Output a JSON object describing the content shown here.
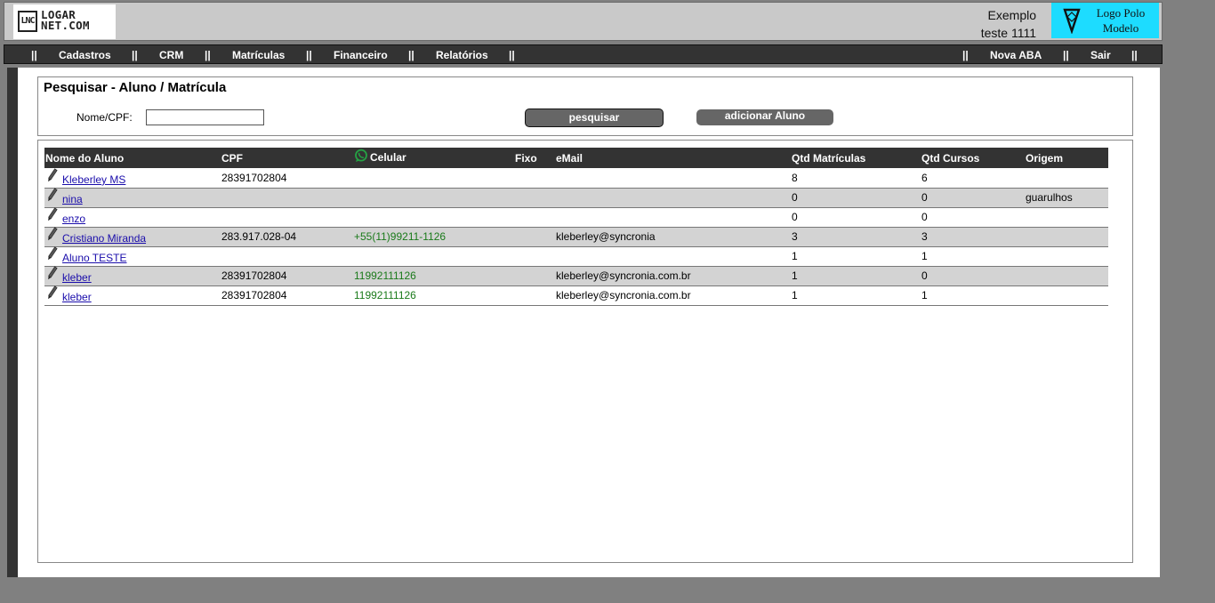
{
  "header": {
    "logo": {
      "mark": "LNC",
      "line1": "LOGAR",
      "line2": "NET.COM"
    },
    "user": {
      "line1": "Exemplo",
      "line2": "teste 1111"
    },
    "polo_logo": {
      "line1": "Logo Polo",
      "line2": "Modelo"
    }
  },
  "nav": {
    "separator": "||",
    "items": [
      "Cadastros",
      "CRM",
      "Matrículas",
      "Financeiro",
      "Relatórios"
    ],
    "right_items": [
      "Nova ABA",
      "Sair"
    ]
  },
  "search": {
    "title": "Pesquisar - Aluno / Matrícula",
    "label": "Nome/CPF:",
    "value": "",
    "search_button": "pesquisar",
    "add_button": "adicionar Aluno"
  },
  "table": {
    "headers": {
      "name": "Nome do Aluno",
      "cpf": "CPF",
      "celular": "Celular",
      "fixo": "Fixo",
      "email": "eMail",
      "matriculas": "Qtd Matrículas",
      "cursos": "Qtd Cursos",
      "origem": "Origem"
    },
    "rows": [
      {
        "name": "Kleberley MS",
        "cpf": "28391702804",
        "celular": "",
        "fixo": "",
        "email": "",
        "matriculas": "8",
        "cursos": "6",
        "origem": ""
      },
      {
        "name": "nina",
        "cpf": "",
        "celular": "",
        "fixo": "",
        "email": "",
        "matriculas": "0",
        "cursos": "0",
        "origem": "guarulhos"
      },
      {
        "name": "enzo",
        "cpf": "",
        "celular": "",
        "fixo": "",
        "email": "",
        "matriculas": "0",
        "cursos": "0",
        "origem": ""
      },
      {
        "name": "Cristiano Miranda",
        "cpf": "283.917.028-04",
        "celular": "+55(11)99211-1126",
        "fixo": "",
        "email": "kleberley@syncronia",
        "matriculas": "3",
        "cursos": "3",
        "origem": ""
      },
      {
        "name": "Aluno TESTE",
        "cpf": "",
        "celular": "",
        "fixo": "",
        "email": "",
        "matriculas": "1",
        "cursos": "1",
        "origem": ""
      },
      {
        "name": "kleber",
        "cpf": "28391702804",
        "celular": "11992111126",
        "fixo": "",
        "email": "kleberley@syncronia.com.br",
        "matriculas": "1",
        "cursos": "0",
        "origem": ""
      },
      {
        "name": "kleber",
        "cpf": "28391702804",
        "celular": "11992111126",
        "fixo": "",
        "email": "kleberley@syncronia.com.br",
        "matriculas": "1",
        "cursos": "1",
        "origem": ""
      }
    ]
  },
  "colors": {
    "page_bg": "#808080",
    "header_bg": "#c9c9c9",
    "nav_bg": "#333333",
    "polo_logo_bg": "#1ddcff",
    "row_alt_bg": "#d3d3d3",
    "phone_green": "#1a7a1a",
    "whatsapp_green": "#25a244"
  }
}
